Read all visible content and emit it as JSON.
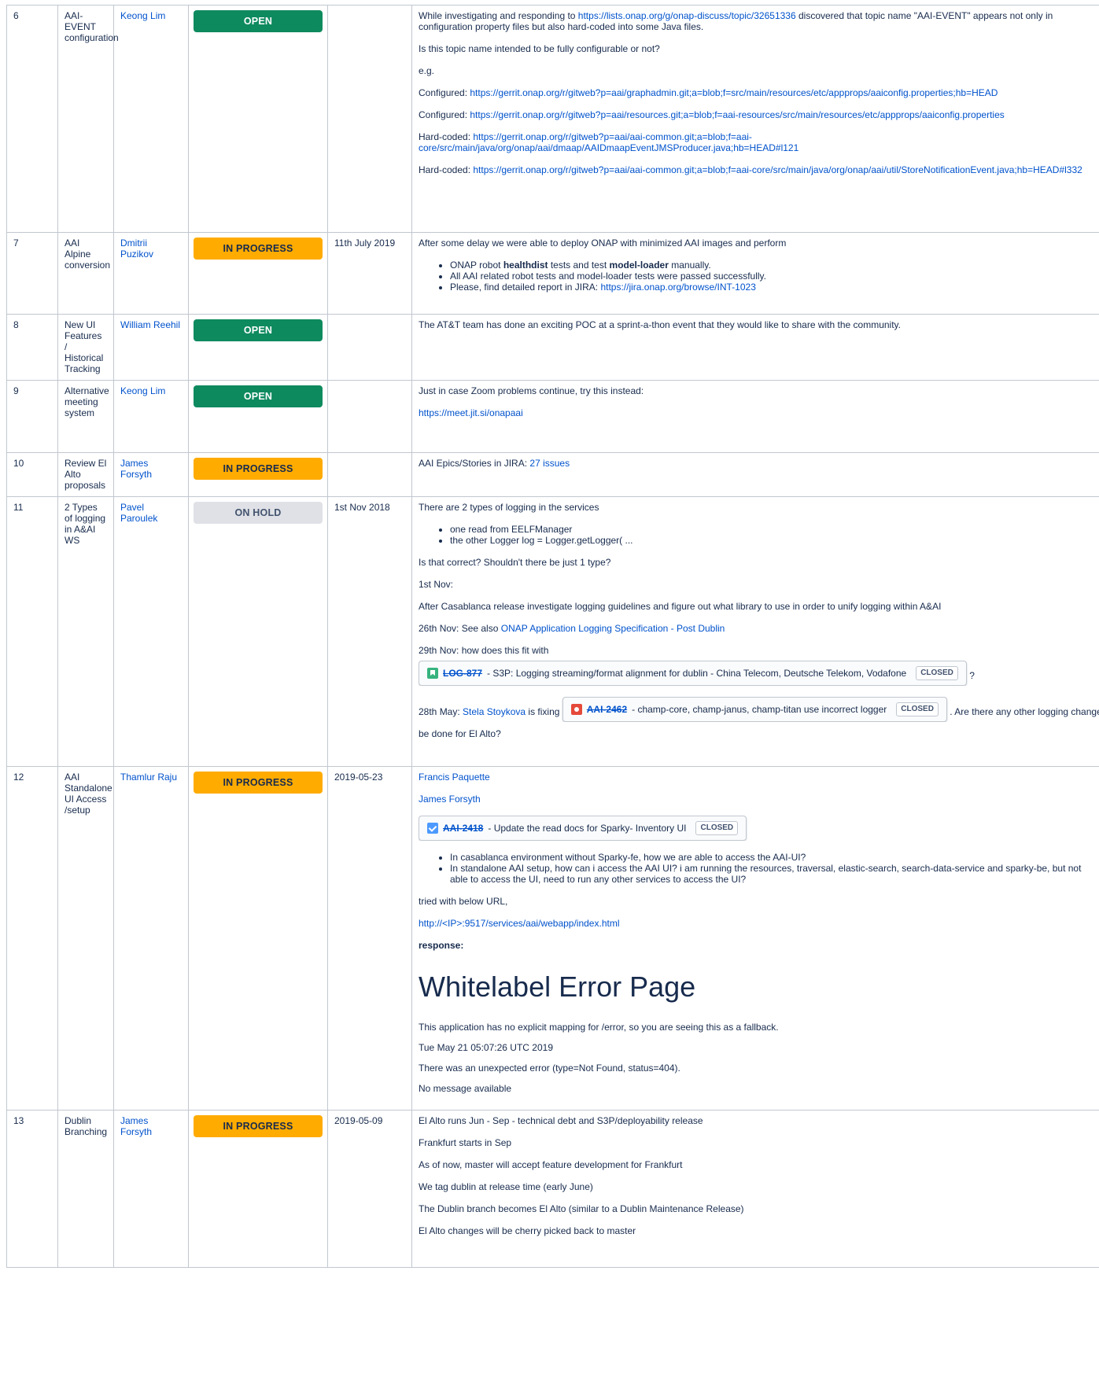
{
  "statuses": {
    "open": "OPEN",
    "in_progress": "IN PROGRESS",
    "on_hold": "ON HOLD",
    "closed": "CLOSED"
  },
  "colors": {
    "open": "#0e8a5f",
    "in_progress": "#ffab00",
    "on_hold": "#dfe1e6",
    "link": "#0052cc"
  },
  "rows": [
    {
      "num": "6",
      "topic": "AAI-EVENT configuration",
      "owner": "Keong Lim",
      "date": "",
      "p1a": "While investigating and responding to ",
      "p1link": "https://lists.onap.org/g/onap-discuss/topic/32651336",
      "p1b": " discovered that topic name \"AAI-EVENT\" appears not only in configuration property files but also hard-coded into some Java files.",
      "p2": "Is this topic name intended to be fully configurable or not?",
      "p3": "e.g.",
      "conf1_label": "Configured: ",
      "conf1_link": "https://gerrit.onap.org/r/gitweb?p=aai/graphadmin.git;a=blob;f=src/main/resources/etc/appprops/aaiconfig.properties;hb=HEAD",
      "conf2_label": "Configured: ",
      "conf2_link": "https://gerrit.onap.org/r/gitweb?p=aai/resources.git;a=blob;f=aai-resources/src/main/resources/etc/appprops/aaiconfig.properties",
      "hard1_label": "Hard-coded: ",
      "hard1_link": "https://gerrit.onap.org/r/gitweb?p=aai/aai-common.git;a=blob;f=aai-core/src/main/java/org/onap/aai/dmaap/AAIDmaapEventJMSProducer.java;hb=HEAD#l121",
      "hard2_label": "Hard-coded: ",
      "hard2_link": "https://gerrit.onap.org/r/gitweb?p=aai/aai-common.git;a=blob;f=aai-core/src/main/java/org/onap/aai/util/StoreNotificationEvent.java;hb=HEAD#l332"
    },
    {
      "num": "7",
      "topic": "AAI Alpine conversion",
      "owner": "Dmitrii Puzikov",
      "date": "11th July 2019",
      "p1": "After some delay we were able to deploy ONAP with minimized AAI images and perform",
      "b1a": "ONAP robot ",
      "b1b": "healthdist",
      "b1c": " tests and test ",
      "b1d": "model-loader",
      "b1e": " manually.",
      "b2": "All AAI related robot tests and model-loader tests were passed successfully.",
      "b3a": "Please, find detailed report in JIRA: ",
      "b3link": "https://jira.onap.org/browse/INT-1023"
    },
    {
      "num": "8",
      "topic": "New UI Features / Historical Tracking",
      "owner": "William Reehil",
      "date": "",
      "p1": "The AT&T team has done an exciting POC at a sprint-a-thon event that they would like to share with the community."
    },
    {
      "num": "9",
      "topic": "Alternative meeting system",
      "owner": "Keong Lim",
      "date": "",
      "p1": "Just in case Zoom problems continue, try this instead:",
      "link": "https://meet.jit.si/onapaai"
    },
    {
      "num": "10",
      "topic": "Review El Alto proposals",
      "owner": "James Forsyth",
      "date": "",
      "p1": "AAI Epics/Stories in JIRA: ",
      "link": "27 issues"
    },
    {
      "num": "11",
      "topic": "2 Types of logging in A&AI WS",
      "owner": "Pavel Paroulek",
      "date": "1st Nov 2018",
      "p1": "There are 2 types of logging in the services",
      "b1": "one read from EELFManager",
      "b2": "the other Logger log = Logger.getLogger( ...",
      "p2": "Is that correct? Shouldn't there be just 1 type?",
      "p3": "1st Nov:",
      "p4": "After Casablanca release investigate logging guidelines and figure out what library to use in order to unify logging within A&AI",
      "p5a": "26th Nov: See also ",
      "p5link": "ONAP Application Logging Specification - Post Dublin",
      "p6": "29th Nov: how does this fit with",
      "j1key": "LOG-877",
      "j1text": " - S3P: Logging streaming/format alignment for dublin - China Telecom, Deutsche Telekom, Vodafone",
      "j1after": " ?",
      "p7a": "28th May: ",
      "p7person": "Stela Stoykova",
      "p7b": " is fixing ",
      "j2key": "AAI-2462",
      "j2text": " - champ-core, champ-janus, champ-titan use incorrect logger",
      "p7c": " . Are there any other logging changes to",
      "p8": "be done for El Alto?"
    },
    {
      "num": "12",
      "topic": "AAI Standalone UI Access /setup",
      "owner": "Thamlur Raju",
      "date": "2019-05-23",
      "person1": "Francis Paquette",
      "person2": "James Forsyth",
      "j1key": "AAI-2418",
      "j1text": " - Update the read docs for Sparky- Inventory UI",
      "b1": "In casablanca environment without Sparky-fe, how we are able to access the AAI-UI?",
      "b2": "In standalone AAI setup, how can i access the AAI UI? i am running the resources, traversal, elastic-search, search-data-service and sparky-be, but not able to access the UI, need to run any other services to access the UI?",
      "p1": "tried with below URL,",
      "url": "http://<IP>:9517/services/aai/webapp/index.html",
      "resp": "response:",
      "wl_title": "Whitelabel Error Page",
      "wl_l1": "This application has no explicit mapping for /error, so you are seeing this as a fallback.",
      "wl_l2": "Tue May 21 05:07:26 UTC 2019",
      "wl_l3": "There was an unexpected error (type=Not Found, status=404).",
      "wl_l4": "No message available"
    },
    {
      "num": "13",
      "topic": "Dublin Branching",
      "owner": "James Forsyth",
      "date": "2019-05-09",
      "p1": "El Alto runs Jun - Sep - technical debt and S3P/deployability release",
      "p2": "Frankfurt starts in Sep",
      "p3": "As of now, master will accept feature development for Frankfurt",
      "p4": "We tag dublin at release time (early June)",
      "p5": "The Dublin branch becomes El Alto (similar to a Dublin Maintenance Release)",
      "p6": "El Alto changes will be cherry picked back to master"
    }
  ]
}
